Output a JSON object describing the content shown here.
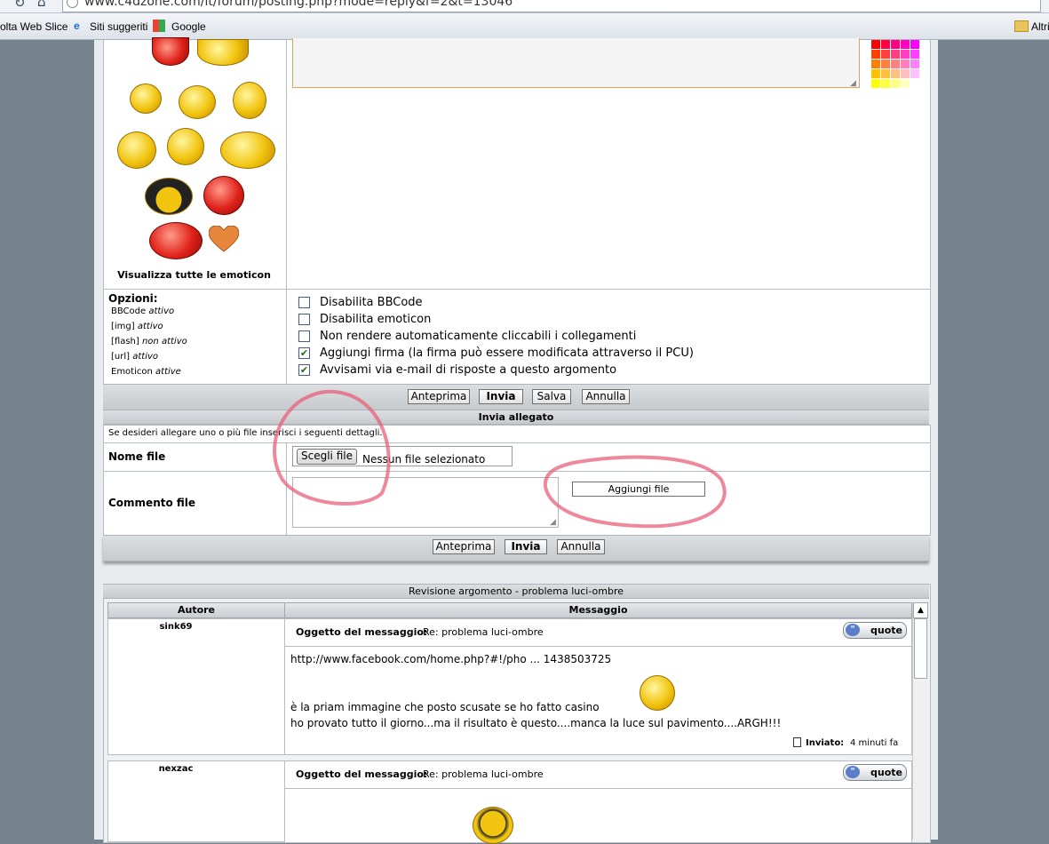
{
  "browser": {
    "url": "www.c4dzone.com/it/forum/posting.php?mode=reply&f=2&t=13046",
    "favorites": [
      "olta Web Slice",
      "Siti suggeriti",
      "Google"
    ],
    "other_bookmarks": "Altri"
  },
  "smilies": {
    "view_all_label": "Visualizza tutte le emoticon"
  },
  "options": {
    "title": "Opzioni:",
    "status_lines": [
      {
        "label": "BBCode",
        "state": "attivo"
      },
      {
        "label": "[img]",
        "state": "attivo"
      },
      {
        "label": "[flash]",
        "state": "non attivo"
      },
      {
        "label": "[url]",
        "state": "attivo"
      },
      {
        "label": "Emoticon",
        "state": "attive"
      }
    ],
    "checkboxes": [
      {
        "label": "Disabilita BBCode",
        "checked": false
      },
      {
        "label": "Disabilita emoticon",
        "checked": false
      },
      {
        "label": "Non rendere automaticamente cliccabili i collegamenti",
        "checked": false
      },
      {
        "label": "Aggiungi firma (la firma può essere modificata attraverso il PCU)",
        "checked": true
      },
      {
        "label": "Avvisami via e-mail di risposte a questo argomento",
        "checked": true
      }
    ]
  },
  "buttons": {
    "preview": "Anteprima",
    "send": "Invia",
    "save": "Salva",
    "cancel": "Annulla"
  },
  "attachment": {
    "title": "Invia allegato",
    "hint": "Se desideri allegare uno o più file inserisci i seguenti dettagli.",
    "file_name_label": "Nome file",
    "choose_file_label": "Scegli file",
    "no_file_label": "Nessun file selezionato",
    "comment_label": "Commento file",
    "add_file_label": "Aggiungi file"
  },
  "review": {
    "title": "Revisione argomento - problema luci-ombre",
    "col_author": "Autore",
    "col_message": "Messaggio",
    "subject_label": "Oggetto del messaggio:",
    "quote_label": "quote",
    "posts": [
      {
        "author": "sink69",
        "subject": "Re: problema luci-ombre",
        "lines": [
          "http://www.facebook.com/home.php?#!/pho ... 1438503725",
          "è la priam immagine che posto scusate se ho fatto casino",
          "ho provato tutto il giorno...ma il risultato è questo....manca la luce sul pavimento....ARGH!!!"
        ],
        "sent_label": "Inviato:",
        "sent_value": "4 minuti fa"
      },
      {
        "author": "nexzac",
        "subject": "Re: problema luci-ombre"
      }
    ]
  },
  "colors": {
    "annotation": "#e8607a",
    "palette": [
      "#ff0000",
      "#ff0040",
      "#ff0080",
      "#ff00c0",
      "#ff00ff",
      "#ff4000",
      "#ff4040",
      "#ff4080",
      "#ff40c0",
      "#ff40ff",
      "#ff8000",
      "#ff8040",
      "#ff8080",
      "#ff80c0",
      "#ff80ff",
      "#ffc000",
      "#ffc040",
      "#ffc080",
      "#ffc0c0",
      "#ffc0ff",
      "#ffff00",
      "#ffff40",
      "#ffff80",
      "#ffffc0",
      "#ffffff"
    ]
  }
}
